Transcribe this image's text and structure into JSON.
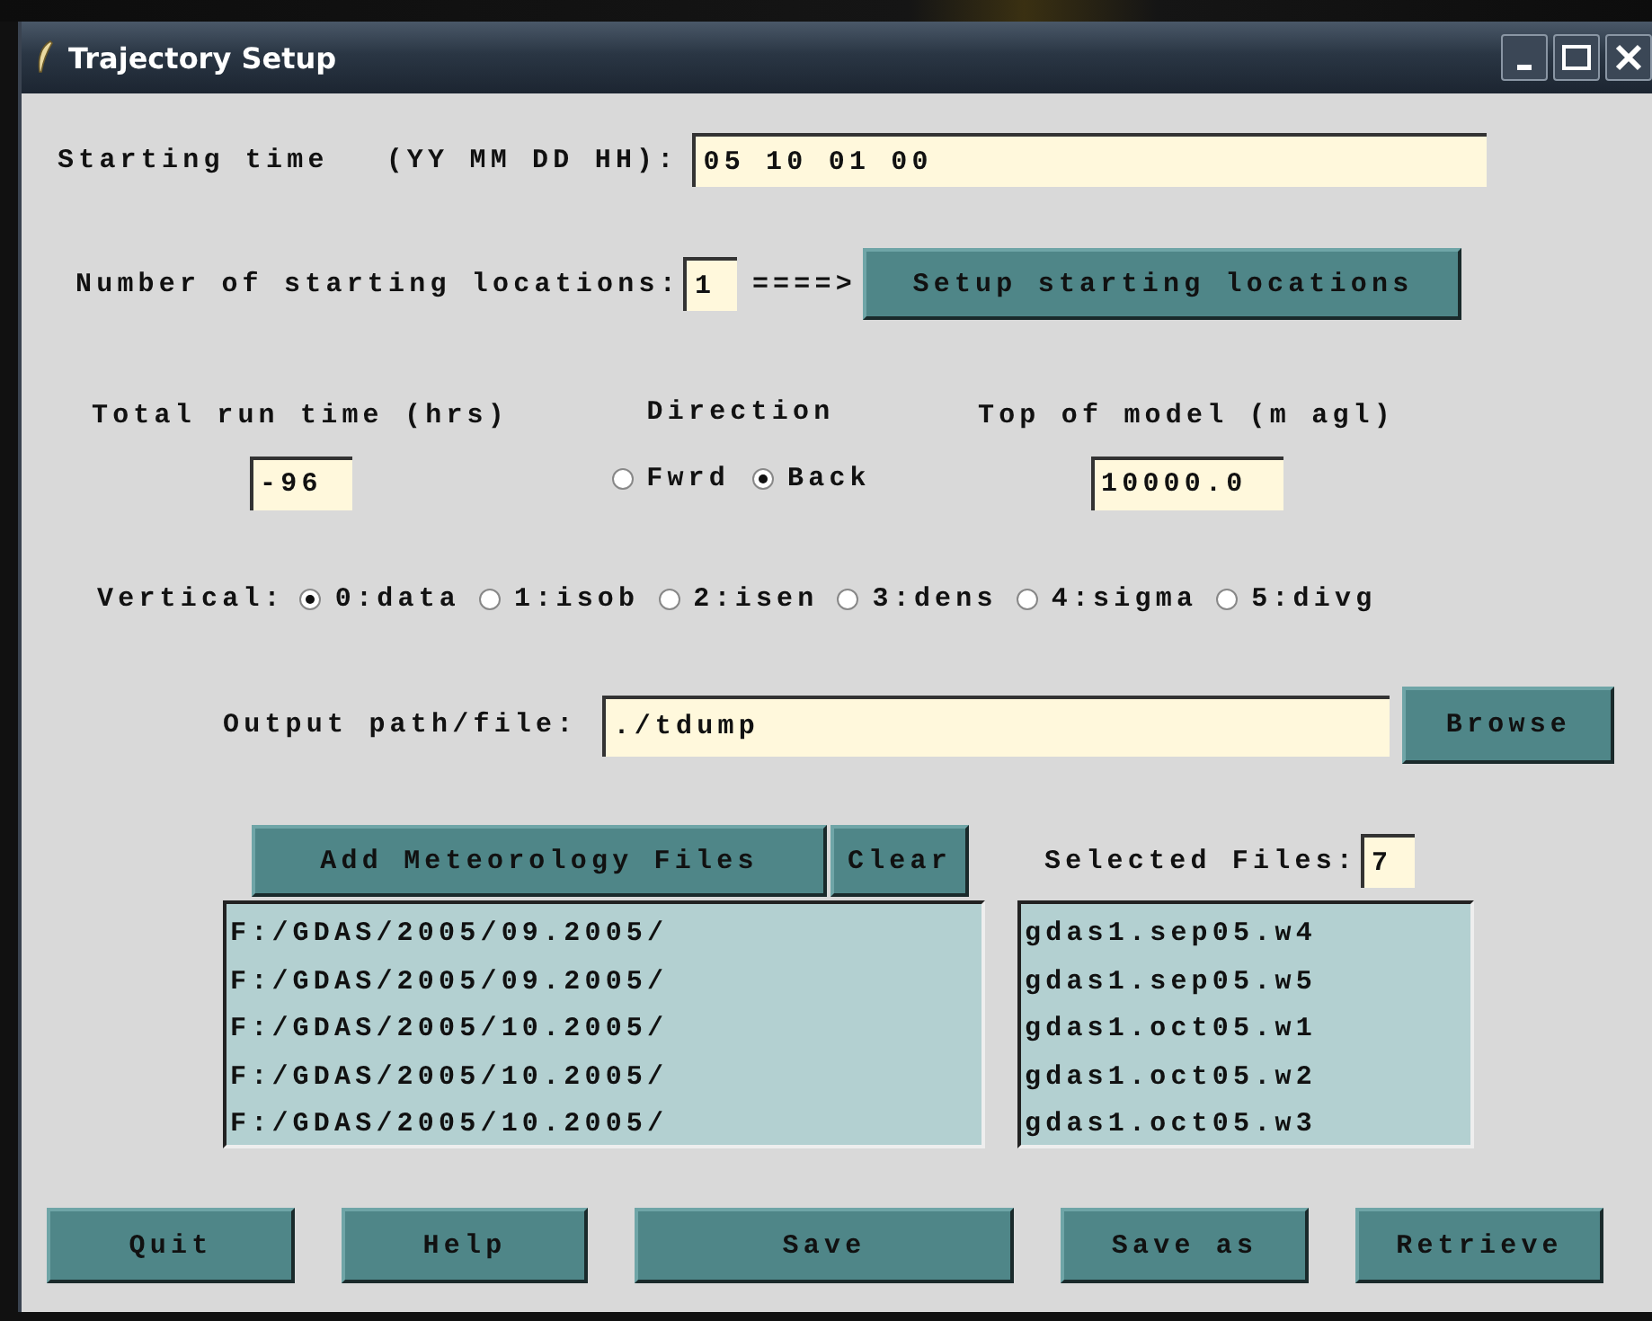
{
  "window": {
    "title": "Trajectory Setup"
  },
  "starting_time": {
    "label": "Starting time",
    "format": "(YY MM DD HH):",
    "value": "05 10 01 00"
  },
  "locations": {
    "label": "Number of starting locations:",
    "value": "1",
    "arrow": "====>",
    "button": "Setup starting locations"
  },
  "run_time": {
    "label": "Total run time (hrs)",
    "value": "-96"
  },
  "direction": {
    "label": "Direction",
    "options": [
      {
        "label": "Fwrd",
        "selected": false
      },
      {
        "label": "Back",
        "selected": true
      }
    ]
  },
  "top_of_model": {
    "label": "Top of model (m agl)",
    "value": "10000.0"
  },
  "vertical": {
    "label": "Vertical:",
    "options": [
      {
        "label": "0:data",
        "selected": true
      },
      {
        "label": "1:isob",
        "selected": false
      },
      {
        "label": "2:isen",
        "selected": false
      },
      {
        "label": "3:dens",
        "selected": false
      },
      {
        "label": "4:sigma",
        "selected": false
      },
      {
        "label": "5:divg",
        "selected": false
      }
    ]
  },
  "output": {
    "label": "Output path/file:",
    "value": "./tdump",
    "button": "Browse"
  },
  "meteorology": {
    "add_button": "Add Meteorology Files",
    "clear_button": "Clear",
    "selected_label": "Selected Files:",
    "selected_count": "7",
    "directories": [
      "F:/GDAS/2005/09.2005/",
      "F:/GDAS/2005/09.2005/",
      "F:/GDAS/2005/10.2005/",
      "F:/GDAS/2005/10.2005/",
      "F:/GDAS/2005/10.2005/"
    ],
    "files": [
      "gdas1.sep05.w4",
      "gdas1.sep05.w5",
      "gdas1.oct05.w1",
      "gdas1.oct05.w2",
      "gdas1.oct05.w3"
    ]
  },
  "buttons": [
    "Quit",
    "Help",
    "Save",
    "Save as",
    "Retrieve"
  ]
}
